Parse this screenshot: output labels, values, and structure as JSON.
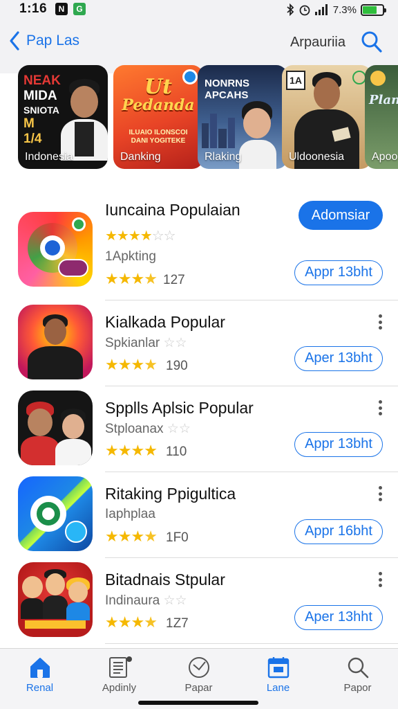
{
  "status_bar": {
    "time": "1:16",
    "battery_text": "7.3%",
    "battery_level": 0.73,
    "battery_color": "#2fbe3c",
    "icons": [
      "notification-n-icon",
      "notification-green-icon",
      "bluetooth-icon",
      "alarm-icon",
      "signal-icon",
      "battery-icon"
    ]
  },
  "header": {
    "back_label": "Pap Las",
    "right_label": "Arpauriia",
    "accent": "#1a73e8"
  },
  "featured": [
    {
      "caption": "Indonesia",
      "headline": [
        "NEAK",
        "MIDA",
        "SNIOTA",
        "M",
        "1/4"
      ]
    },
    {
      "caption": "Danking",
      "headline": [
        "Ut",
        "Pedanda"
      ],
      "subline": [
        "ILUAIO ILONSCOI",
        "DANI YOGITEKE"
      ]
    },
    {
      "caption": "Rlaking",
      "headline": [
        "NONRNS",
        "APCAHS"
      ]
    },
    {
      "caption": "Uldoonesia",
      "headline": [
        "1A"
      ]
    },
    {
      "caption": "Apoo",
      "headline": [
        "Plana"
      ]
    }
  ],
  "apps": [
    {
      "name": "Iuncaina Populaian",
      "subtitle": "1Apkting",
      "rating": 3.5,
      "rating_count": "127",
      "primary_button": "Adomsiar",
      "secondary_button": "Appr 13bht"
    },
    {
      "name": "Kialkada Popular",
      "subtitle": "Spkianlar",
      "rating": 3.5,
      "rating_count": "190",
      "secondary_button": "Aper 13bht"
    },
    {
      "name": "Spplls Aplsic Popular",
      "subtitle": "Stploanax",
      "rating": 4,
      "rating_count": "110",
      "secondary_button": "Appr 13bht"
    },
    {
      "name": "Ritaking Ppigultica",
      "subtitle": "Iaphplaa",
      "rating": 3.5,
      "rating_count": "1F0",
      "secondary_button": "Appr 16bht"
    },
    {
      "name": "Bitadnais Stpular",
      "subtitle": "Indinaura",
      "rating": 3.5,
      "rating_count": "1Z7",
      "secondary_button": "Aper 13hht"
    }
  ],
  "tabs": [
    {
      "label": "Renal",
      "icon": "home-icon",
      "active": true
    },
    {
      "label": "Apdinly",
      "icon": "document-icon",
      "active": false
    },
    {
      "label": "Papar",
      "icon": "clock-icon",
      "active": false
    },
    {
      "label": "Lane",
      "icon": "calendar-icon",
      "active": false
    },
    {
      "label": "Papor",
      "icon": "search-icon",
      "active": false
    }
  ]
}
